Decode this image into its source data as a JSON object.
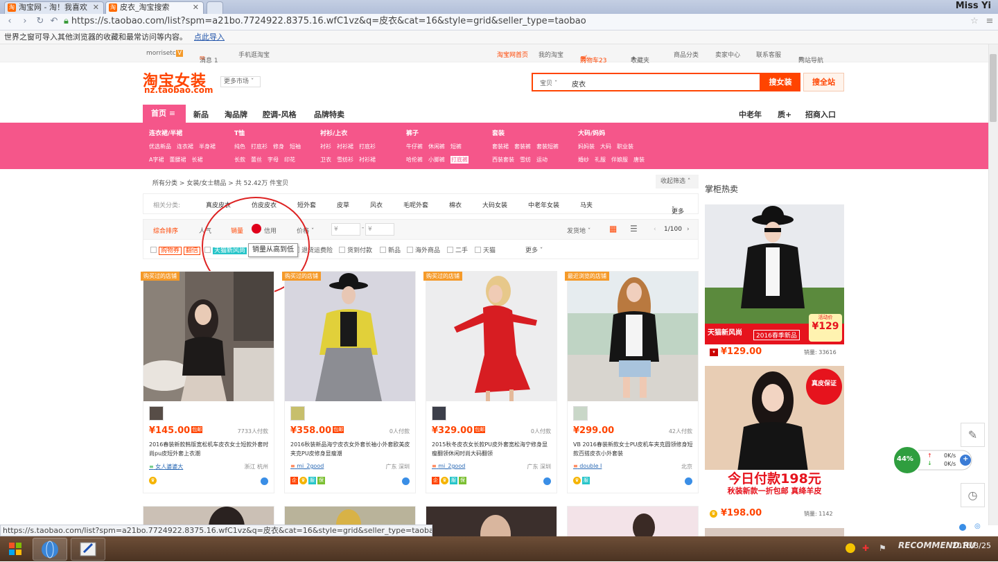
{
  "browser": {
    "tabs": [
      {
        "label": "淘宝网 - 淘！我喜欢"
      },
      {
        "label": "皮衣_淘宝搜索"
      },
      {
        "label": ""
      }
    ],
    "user": "Miss Yi",
    "url": "https://s.taobao.com/list?spm=a21bo.7724922.8375.16.wfC1vz&q=皮衣&cat=16&style=grid&seller_type=taobao",
    "import_text": "世界之窗可导入其他浏览器的收藏和最常访问等内容。",
    "import_link": "点此导入",
    "status_url": "https://s.taobao.com/list?spm=a21bo.7724922.8375.16.wfC1vz&q=皮衣&cat=16&style=grid&seller_type=taobao#"
  },
  "sitenav": {
    "user": "morrisetc",
    "messages": "消息 1",
    "mobile": "手机逛淘宝",
    "home": "淘宝网首页",
    "my": "我的淘宝",
    "cart": "购物车23",
    "fav": "收藏夹",
    "categories": "商品分类",
    "seller": "卖家中心",
    "service": "联系客服",
    "sitemap": "网站导航"
  },
  "header": {
    "logo_text": "淘宝女装",
    "logo_domain": "nz.taobao.com",
    "more_markets": "更多市场",
    "search_category": "宝贝",
    "search_query": "皮衣",
    "search_btn": "搜女装",
    "search_all_btn": "搜全站"
  },
  "mainnav": {
    "home": "首页",
    "items": [
      "新品",
      "淘品牌",
      "腔调-风格",
      "品牌特卖"
    ],
    "right_items": [
      "中老年",
      "质+",
      "招商入口"
    ]
  },
  "banner": {
    "columns": [
      {
        "title": "连衣裙/半裙",
        "row1": [
          "优选新品",
          "连衣裙",
          "半身裙"
        ],
        "row2": [
          "A字裙",
          "蕾腰裙",
          "长裙"
        ]
      },
      {
        "title": "T恤",
        "row1": [
          "纯色",
          "打底衫",
          "修身",
          "短袖"
        ],
        "row2": [
          "长款",
          "蕾丝",
          "字母",
          "印花"
        ]
      },
      {
        "title": "衬衫/上衣",
        "row1": [
          "衬衫",
          "衬衫裙",
          "打底衫"
        ],
        "row2": [
          "卫衣",
          "雪纺衫",
          "衬衫裙"
        ]
      },
      {
        "title": "裤子",
        "row1": [
          "牛仔裤",
          "休闲裤",
          "短裤"
        ],
        "row2": [
          "哈伦裤",
          "小脚裤",
          "打底裤"
        ]
      },
      {
        "title": "套装",
        "row1": [
          "套装裙",
          "套装裤",
          "套装短裤"
        ],
        "row2": [
          "西装套装",
          "雪纺",
          "运动"
        ]
      },
      {
        "title": "大码/妈妈",
        "row1": [
          "妈妈装",
          "大码",
          "职业装"
        ],
        "row2": [
          "婚纱",
          "礼服",
          "伴娘服",
          "唐装"
        ]
      }
    ]
  },
  "breadcrumb": {
    "all": "所有分类",
    "sep": ">",
    "cat": "女装/女士精品",
    "count": "共 52.42万 件宝贝"
  },
  "collapse": "收起筛选",
  "related": {
    "label": "相关分类:",
    "items": [
      "真皮皮衣",
      "仿皮皮衣",
      "短外套",
      "皮草",
      "风衣",
      "毛呢外套",
      "棉衣",
      "大码女装",
      "中老年女装",
      "马夹"
    ],
    "more": "更多"
  },
  "sort": {
    "items": [
      "综合排序",
      "人气",
      "销量",
      "信用",
      "价格"
    ],
    "price_from": "¥",
    "price_to": "¥",
    "ship_from": "发货地",
    "page": "1/100"
  },
  "filters": {
    "items": [
      "购物券",
      "翻倍",
      "天猫新风尚",
      "退货运费险",
      "货到付款",
      "新品",
      "海外商品",
      "二手",
      "天猫"
    ],
    "more": "更多"
  },
  "tooltip": "销量从高到低",
  "products": [
    {
      "badge": "购买过的店铺",
      "price": "¥145.00",
      "baoyou": "包邮",
      "sold": "7733人付款",
      "title": "2016春装新款韩版宽松机车皮衣女士短款外套时尚pu皮短外套上衣潮",
      "shop": "女人婆婆大",
      "location": "浙江 杭州"
    },
    {
      "badge": "购买过的店铺",
      "price": "¥358.00",
      "baoyou": "包邮",
      "sold": "0人付款",
      "title": "2016秋装新品海宁皮衣女外套长袖小外套欧美皮夹克PU皮修身显瘦潮",
      "shop": "mi_2good",
      "location": "广东 深圳"
    },
    {
      "badge": "购买过的店铺",
      "price": "¥329.00",
      "baoyou": "包邮",
      "sold": "0人付款",
      "title": "2015秋冬皮衣女长款PU皮外套宽松海宁修身显瘦翻领休闲时尚大码翻领",
      "shop": "mi_2good",
      "location": "广东 深圳"
    },
    {
      "badge": "最近浏览的店铺",
      "price": "¥299.00",
      "baoyou": "",
      "sold": "42人付款",
      "title": "VB 2016春装新款女士PU皮机车夹克圆领修身短款百搭皮衣小外套装",
      "shop": "double I",
      "location": "北京"
    }
  ],
  "hot": {
    "title": "掌柜热卖",
    "items": [
      {
        "banner": "天猫新风尚",
        "season": "2016春季新品",
        "tag": "活动价",
        "tag_price": "¥129",
        "price": "¥129.00",
        "sold": "销量: 33616"
      },
      {
        "banner": "今日付款198元",
        "sub": "秋装新款一折包邮 真绛羊皮",
        "stamp": "真皮保证",
        "price": "¥198.00",
        "sold": "销量: 1142"
      }
    ]
  },
  "netwidget": {
    "percent": "44%",
    "up": "0K/s",
    "down": "0K/s"
  },
  "taskbar": {
    "time": "",
    "date": "2016/3/25"
  },
  "watermark": "RECOMMEND.RU"
}
